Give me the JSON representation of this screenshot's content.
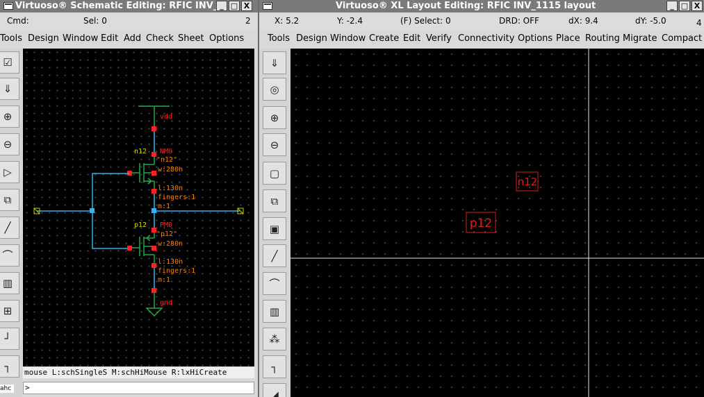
{
  "colors": {
    "wire": "#33b3ee",
    "device": "#22aa44",
    "pin_red": "#ff2222",
    "label_orange": "#ff7f00",
    "net_yellow": "#d8d800",
    "canvas": "#000000",
    "titlebar": "#7a7a7a"
  },
  "schematic_window": {
    "title": "Virtuoso® Schematic Editing: RFIC INV_",
    "controls": {
      "minimize": "_",
      "maximize": "□",
      "close": "X"
    },
    "status": {
      "cmd": "Cmd:",
      "sel": "Sel: 0",
      "number": "2"
    },
    "menu": [
      "Tools",
      "Design",
      "Window",
      "Edit",
      "Add",
      "Check",
      "Sheet",
      "Options"
    ],
    "toolbar_icons": [
      "check-icon",
      "save-icon",
      "zoom-in-icon",
      "zoom-out-icon",
      "stretch-icon",
      "copy-icon",
      "wire-icon",
      "arc-icon",
      "bus-icon",
      "instance-icon",
      "pin-icon",
      "route-icon"
    ],
    "toolbar_glyphs": [
      "☑",
      "⇓",
      "⊕",
      "⊖",
      "▷",
      "⧉",
      "╱",
      "⌒",
      "▥",
      "⊞",
      "┘",
      "┐"
    ],
    "schematic": {
      "net_vdd": "vdd",
      "net_gnd": "gnd",
      "nmos": {
        "instance": "n12",
        "name": "NM0",
        "model": "\"n12\"",
        "w": "w:280n",
        "l": "l:130n",
        "fingers": "fingers:1",
        "m": "m:1"
      },
      "pmos": {
        "instance": "p12",
        "name": "PM0",
        "model": "\"p12\"",
        "w": "w:280n",
        "l": "l:130n",
        "fingers": "fingers:1",
        "m": "m:1"
      }
    },
    "mouse_line": "mouse L:schSingleS M:schHiMouse R:lxHiCreate",
    "prompt": ">",
    "corner_tag": "ahc"
  },
  "layout_window": {
    "title": "Virtuoso® XL Layout Editing: RFIC INV_1115 layout",
    "controls": {
      "minimize": "_",
      "maximize": "□",
      "close": "X"
    },
    "status": {
      "x": "X:  5.2",
      "y": "Y: -2.4",
      "select": "(F) Select: 0",
      "drd": "DRD: OFF",
      "dx": "dX:  9.4",
      "dy": "dY: -5.0",
      "number": "4"
    },
    "menu": [
      "Tools",
      "Design",
      "Window",
      "Create",
      "Edit",
      "Verify",
      "Connectivity",
      "Options",
      "Place",
      "Routing",
      "Migrate",
      "Compact"
    ],
    "toolbar_icons": [
      "save-icon",
      "zoom-fit-icon",
      "zoom-in-icon",
      "zoom-out-icon",
      "stretch-icon",
      "copy-icon",
      "move-icon",
      "path-icon",
      "arc-icon",
      "ruler-icon",
      "via-icon",
      "route-icon",
      "delete-icon"
    ],
    "toolbar_glyphs": [
      "⇓",
      "◎",
      "⊕",
      "⊖",
      "▢",
      "⧉",
      "▣",
      "╱",
      "⌒",
      "▥",
      "⁂",
      "┐",
      "◢"
    ],
    "instances": [
      {
        "label": "n12"
      },
      {
        "label": "p12"
      }
    ]
  }
}
